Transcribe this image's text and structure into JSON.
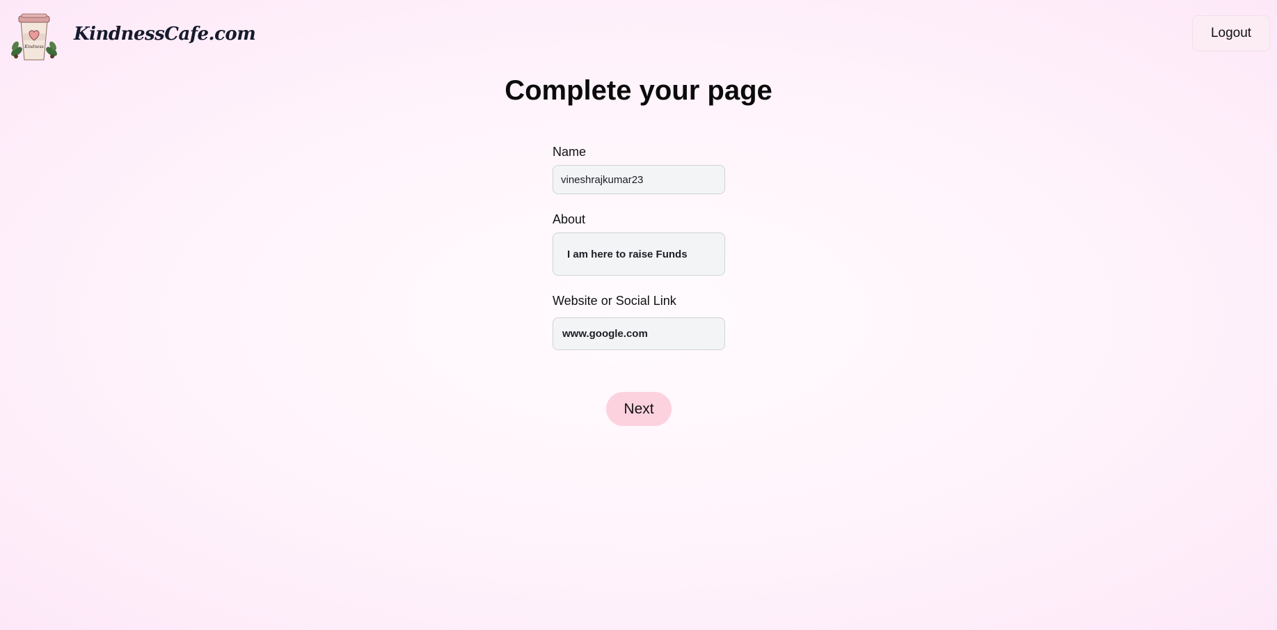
{
  "header": {
    "brand": "KindnessCafe.com",
    "logo_icon": "coffee-cup-logo-icon",
    "logo_cup_text": "Kindness",
    "logout_label": "Logout"
  },
  "main": {
    "title": "Complete your page",
    "fields": {
      "name": {
        "label": "Name",
        "value": "vineshrajkumar23"
      },
      "about": {
        "label": "About",
        "value": "I am here to raise Funds"
      },
      "website": {
        "label": "Website or Social Link",
        "value": "www.google.com"
      }
    },
    "next_label": "Next"
  },
  "colors": {
    "background": "#fff3fb",
    "field_bg": "#f2f4f6",
    "next_button": "#fdd2df",
    "logout_button": "#fcedf5"
  }
}
